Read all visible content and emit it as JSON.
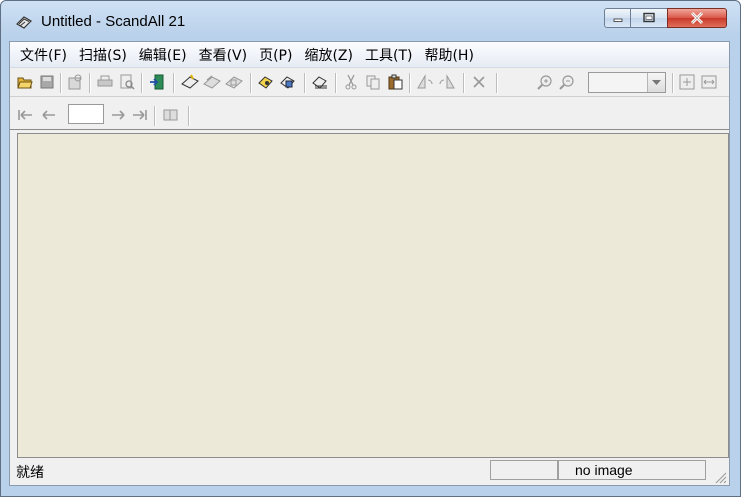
{
  "window": {
    "title": "Untitled - ScandAll 21"
  },
  "menubar": {
    "items": [
      "文件(F)",
      "扫描(S)",
      "编辑(E)",
      "查看(V)",
      "页(P)",
      "缩放(Z)",
      "工具(T)",
      "帮助(H)"
    ]
  },
  "toolbar": {
    "zoom_value": ""
  },
  "navbar": {
    "page_value": ""
  },
  "status": {
    "message": "就绪",
    "pane1": "",
    "pane2": "no image"
  },
  "colors": {
    "document_background": "#ece9d8",
    "titlebar": "#b9d1ea",
    "close_button": "#c7392a"
  }
}
